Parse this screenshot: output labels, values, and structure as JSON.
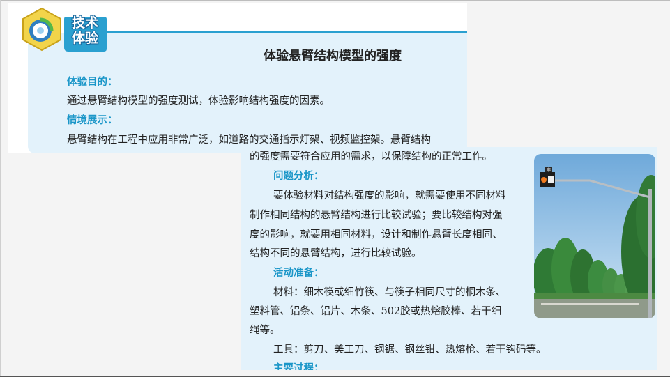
{
  "badge": {
    "line1": "技术",
    "line2": "体验"
  },
  "title": "体验悬臂结构模型的强度",
  "sections": {
    "purpose": {
      "heading": "体验目的：",
      "text": "通过悬臂结构模型的强度测试，体验影响结构强度的因素。"
    },
    "scenario": {
      "heading": "情境展示：",
      "line1": "悬臂结构在工程中应用非常广泛，如道路的交通指示灯架、视频监控架。悬臂结构",
      "line2": "的强度需要符合应用的需求，以保障结构的正常工作。"
    },
    "analysis": {
      "heading": "问题分析：",
      "lines": [
        "要体验材料对结构强度的影响，就需要使用不同材料",
        "制作相同结构的悬臂结构进行比较试验；要比较结构对强",
        "度的影响，就要用相同材料，设计和制作悬臂长度相同、",
        "结构不同的悬臂结构，进行比较试验。"
      ]
    },
    "preparation": {
      "heading": "活动准备：",
      "materials_lines": [
        "材料：细木筷或细竹筷、与筷子相同尺寸的桐木条、",
        "塑料管、铝条、铝片、木条、502胶或热熔胶棒、若干细",
        "绳等。"
      ],
      "tools_line": "工具：剪刀、美工刀、钢锯、钢丝钳、热熔枪、若干钩码等。"
    },
    "process": {
      "heading": "主要过程："
    }
  },
  "photo": {
    "sign_text": "非"
  }
}
